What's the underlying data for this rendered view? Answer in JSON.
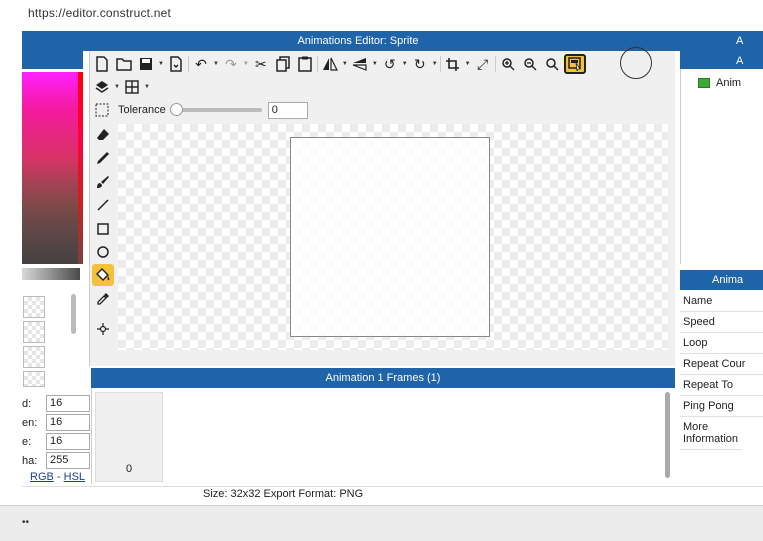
{
  "browser": {
    "url": "https://editor.construct.net"
  },
  "editor": {
    "title": "Animations Editor: Sprite",
    "right_panel_title": "A",
    "tolerance_label": "Tolerance",
    "tolerance_value": "0",
    "tolerance_level": 0
  },
  "color_panel": {
    "rows": [
      {
        "label": "d:",
        "value": "16"
      },
      {
        "label": "en:",
        "value": "16"
      },
      {
        "label": "e:",
        "value": "16"
      },
      {
        "label": "ha:",
        "value": "255"
      }
    ],
    "link_rgb": "RGB",
    "link_sep": " - ",
    "link_hsl": "HSL"
  },
  "frames": {
    "title": "Animation 1 Frames (1)",
    "frame_label": "0"
  },
  "status": {
    "text": "Size: 32x32   Export Format: PNG"
  },
  "bottom": {
    "dots": "••"
  },
  "animations_list": {
    "item": "Anim"
  },
  "properties": {
    "title": "Anima",
    "items": [
      "Name",
      "Speed",
      "Loop",
      "Repeat Cour",
      "Repeat To",
      "Ping Pong",
      "More Information"
    ]
  },
  "icons": {
    "toolbar": [
      "new-icon",
      "open-icon",
      "save-icon",
      "export-icon",
      "undo-icon",
      "redo-icon",
      "cut-icon",
      "copy-icon",
      "paste-icon",
      "mirror-icon",
      "flip-icon",
      "rotate-ccw-icon",
      "rotate-cw-icon",
      "crop-icon",
      "resize-icon",
      "zoom-in-icon",
      "zoom-out-icon",
      "zoom-reset-icon",
      "toggle-preview-icon"
    ],
    "tools": [
      "eraser-icon",
      "pencil-icon",
      "brush-icon",
      "line-icon",
      "rectangle-icon",
      "ellipse-icon",
      "fill-icon",
      "eyedropper-icon",
      "origin-icon"
    ]
  },
  "colors": {
    "header_blue": "#1f63a8",
    "highlight": "#f3c23a",
    "anim_icon": "#3aaa35"
  }
}
